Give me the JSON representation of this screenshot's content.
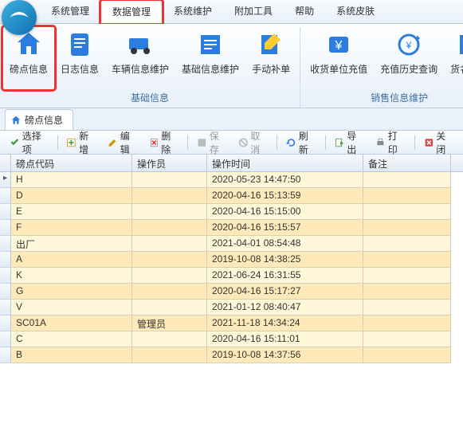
{
  "menu": {
    "items": [
      "系统管理",
      "数据管理",
      "系统维护",
      "附加工具",
      "帮助",
      "系统皮肤"
    ],
    "active_index": 1
  },
  "ribbon": {
    "groups": [
      {
        "label": "基础信息",
        "buttons": [
          {
            "name": "station-info",
            "label": "磅点信息"
          },
          {
            "name": "log-info",
            "label": "日志信息"
          },
          {
            "name": "vehicle-info",
            "label": "车辆信息维护"
          },
          {
            "name": "basic-info",
            "label": "基础信息维护"
          },
          {
            "name": "manual-order",
            "label": "手动补单"
          }
        ]
      },
      {
        "label": "销售信息维护",
        "buttons": [
          {
            "name": "recharge",
            "label": "收货单位充值"
          },
          {
            "name": "recharge-history",
            "label": "充值历史查询"
          },
          {
            "name": "goods-maint",
            "label": "货名维护"
          }
        ]
      }
    ]
  },
  "doc_tab": {
    "label": "磅点信息"
  },
  "toolbar": {
    "select": "选择项",
    "add": "新增",
    "edit": "编辑",
    "delete": "删除",
    "save": "保存",
    "cancel": "取消",
    "refresh": "刷新",
    "export": "导出",
    "print": "打印",
    "close": "关闭"
  },
  "grid": {
    "columns": [
      "磅点代码",
      "操作员",
      "操作时间",
      "备注"
    ],
    "rows": [
      {
        "code": "H",
        "op": "",
        "time": "2020-05-23 14:47:50",
        "note": ""
      },
      {
        "code": "D",
        "op": "",
        "time": "2020-04-16 15:13:59",
        "note": ""
      },
      {
        "code": "E",
        "op": "",
        "time": "2020-04-16 15:15:00",
        "note": ""
      },
      {
        "code": "F",
        "op": "",
        "time": "2020-04-16 15:15:57",
        "note": ""
      },
      {
        "code": "出厂",
        "op": "",
        "time": "2021-04-01 08:54:48",
        "note": ""
      },
      {
        "code": "A",
        "op": "",
        "time": "2019-10-08 14:38:25",
        "note": ""
      },
      {
        "code": "K",
        "op": "",
        "time": "2021-06-24 16:31:55",
        "note": ""
      },
      {
        "code": "G",
        "op": "",
        "time": "2020-04-16 15:17:27",
        "note": ""
      },
      {
        "code": "V",
        "op": "",
        "time": "2021-01-12 08:40:47",
        "note": ""
      },
      {
        "code": "SC01A",
        "op": "管理员",
        "time": "2021-11-18 14:34:24",
        "note": ""
      },
      {
        "code": "C",
        "op": "",
        "time": "2020-04-16 15:11:01",
        "note": ""
      },
      {
        "code": "B",
        "op": "",
        "time": "2019-10-08 14:37:56",
        "note": ""
      }
    ]
  }
}
